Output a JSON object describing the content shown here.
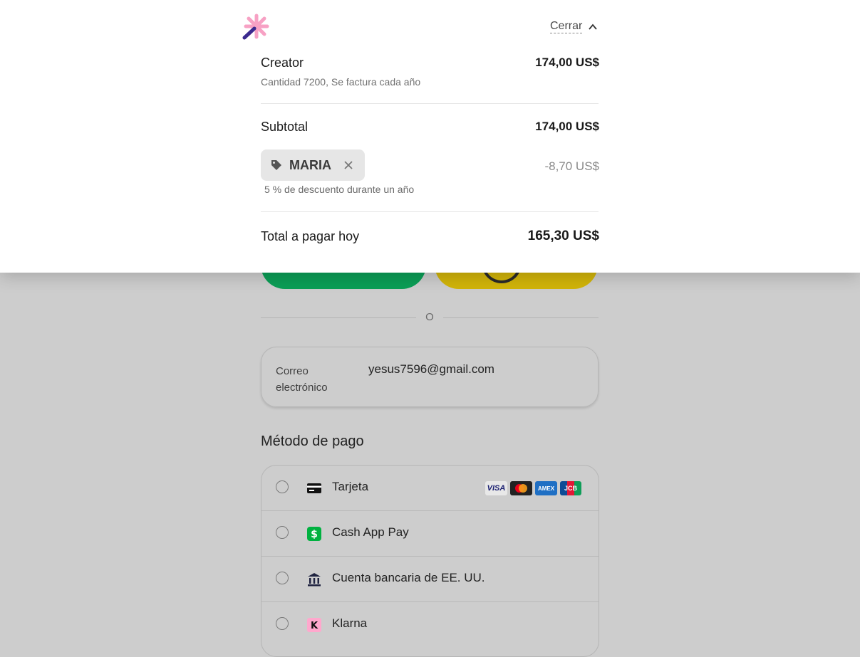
{
  "colors": {
    "overlay_bg": "#cdcdcd",
    "panel_bg": "#ffffff",
    "wallet_green": "#0b9e56",
    "wallet_yellow": "#d1b409",
    "cashapp_green": "#00b140",
    "klarna_pink": "#ffa8cd",
    "logo_pink": "#f7a1c4",
    "logo_purple": "#3b2a8f"
  },
  "summary": {
    "close_label": "Cerrar",
    "item": {
      "name": "Creator",
      "price": "174,00 US$",
      "detail": "Cantidad 7200, Se factura cada año"
    },
    "subtotal": {
      "label": "Subtotal",
      "value": "174,00 US$"
    },
    "promo": {
      "code": "MARIA",
      "discount": "-8,70 US$",
      "note": "5 % de descuento durante un año"
    },
    "total": {
      "label": "Total a pagar hoy",
      "value": "165,30 US$"
    }
  },
  "checkout": {
    "or_text": "O",
    "email": {
      "label": "Correo electrónico",
      "value": "yesus7596@gmail.com"
    },
    "payment_title": "Método de pago",
    "methods": [
      {
        "label": "Tarjeta",
        "icon": "card-icon"
      },
      {
        "label": "Cash App Pay",
        "icon": "cashapp-icon"
      },
      {
        "label": "Cuenta bancaria de EE. UU.",
        "icon": "bank-icon"
      },
      {
        "label": "Klarna",
        "icon": "klarna-icon"
      }
    ],
    "card_brands": {
      "visa": "VISA",
      "amex": "AMEX",
      "jcb": "JCB"
    }
  }
}
